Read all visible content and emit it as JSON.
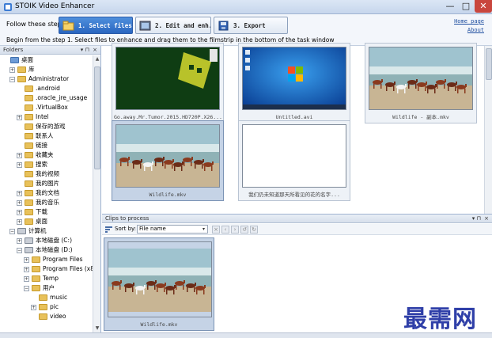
{
  "window": {
    "title": "STOIK Video Enhancer",
    "minimize": "—",
    "maximize": "□",
    "close": "✕"
  },
  "steps": {
    "label": "Follow these steps:",
    "step1": "1. Select files",
    "step2": "2. Edit and enh...",
    "step3": "3. Export",
    "hint": "Begin from the step 1. Select files to enhance and drag them to the filmstrip in the bottom of the task window"
  },
  "links": {
    "home": "Home page",
    "about": "About"
  },
  "folders": {
    "title": "Folders",
    "pin": "▾ ⊓",
    "close": "×",
    "tree": [
      {
        "label": "桌面",
        "indent": 0,
        "exp": "",
        "icon": "blue"
      },
      {
        "label": "库",
        "indent": 1,
        "exp": "+",
        "icon": "yellow"
      },
      {
        "label": "Administrator",
        "indent": 1,
        "exp": "−",
        "icon": "yellow"
      },
      {
        "label": ".android",
        "indent": 2,
        "exp": "",
        "icon": "yellow"
      },
      {
        "label": ".oracle_jre_usage",
        "indent": 2,
        "exp": "",
        "icon": "yellow"
      },
      {
        "label": ".VirtualBox",
        "indent": 2,
        "exp": "",
        "icon": "yellow"
      },
      {
        "label": "Intel",
        "indent": 2,
        "exp": "+",
        "icon": "yellow"
      },
      {
        "label": "保存的游戏",
        "indent": 2,
        "exp": "",
        "icon": "yellow"
      },
      {
        "label": "联系人",
        "indent": 2,
        "exp": "",
        "icon": "yellow"
      },
      {
        "label": "链接",
        "indent": 2,
        "exp": "",
        "icon": "yellow"
      },
      {
        "label": "收藏夹",
        "indent": 2,
        "exp": "+",
        "icon": "yellow"
      },
      {
        "label": "搜索",
        "indent": 2,
        "exp": "+",
        "icon": "yellow"
      },
      {
        "label": "我的视频",
        "indent": 2,
        "exp": "",
        "icon": "yellow"
      },
      {
        "label": "我的图片",
        "indent": 2,
        "exp": "",
        "icon": "yellow"
      },
      {
        "label": "我的文档",
        "indent": 2,
        "exp": "+",
        "icon": "yellow"
      },
      {
        "label": "我的音乐",
        "indent": 2,
        "exp": "+",
        "icon": "yellow"
      },
      {
        "label": "下载",
        "indent": 2,
        "exp": "+",
        "icon": "yellow"
      },
      {
        "label": "桌面",
        "indent": 2,
        "exp": "+",
        "icon": "yellow"
      },
      {
        "label": "计算机",
        "indent": 1,
        "exp": "−",
        "icon": "drive"
      },
      {
        "label": "本地磁盘 (C:)",
        "indent": 2,
        "exp": "+",
        "icon": "drive"
      },
      {
        "label": "本地磁盘 (D:)",
        "indent": 2,
        "exp": "−",
        "icon": "drive"
      },
      {
        "label": "Program Files",
        "indent": 3,
        "exp": "+",
        "icon": "yellow"
      },
      {
        "label": "Program Files (x8",
        "indent": 3,
        "exp": "+",
        "icon": "yellow"
      },
      {
        "label": "Temp",
        "indent": 3,
        "exp": "+",
        "icon": "yellow"
      },
      {
        "label": "用户",
        "indent": 3,
        "exp": "−",
        "icon": "yellow"
      },
      {
        "label": "music",
        "indent": 4,
        "exp": "",
        "icon": "yellow"
      },
      {
        "label": "pic",
        "indent": 4,
        "exp": "+",
        "icon": "yellow"
      },
      {
        "label": "video",
        "indent": 4,
        "exp": "",
        "icon": "yellow"
      }
    ]
  },
  "filmstrip": {
    "tiles": [
      {
        "caption": "Go.away.Mr.Tumor.2015.HD720P.X26...",
        "thumb": "green"
      },
      {
        "caption": "Untitled.avi",
        "thumb": "desktop"
      },
      {
        "caption": "Wildlife - 副本.mkv",
        "thumb": "horses"
      },
      {
        "caption": "Wildlife.mkv",
        "thumb": "horses",
        "selected": true
      },
      {
        "caption": "我们仍未知道那天所看见的花的名字...",
        "thumb": "blank"
      }
    ]
  },
  "clips": {
    "title": "Clips to process",
    "pin": "▾ ⊓",
    "close": "×",
    "sort_label": "Sort by:",
    "sort_value": "File name",
    "sort_arrow": "▾",
    "tb_close": "×",
    "items": [
      {
        "caption": "Wildlife.mkv"
      }
    ]
  },
  "watermark": "最需网",
  "colors": {
    "accent": "#2a66c0",
    "panel": "#d6dfec",
    "selected": "#c5d3e6"
  }
}
